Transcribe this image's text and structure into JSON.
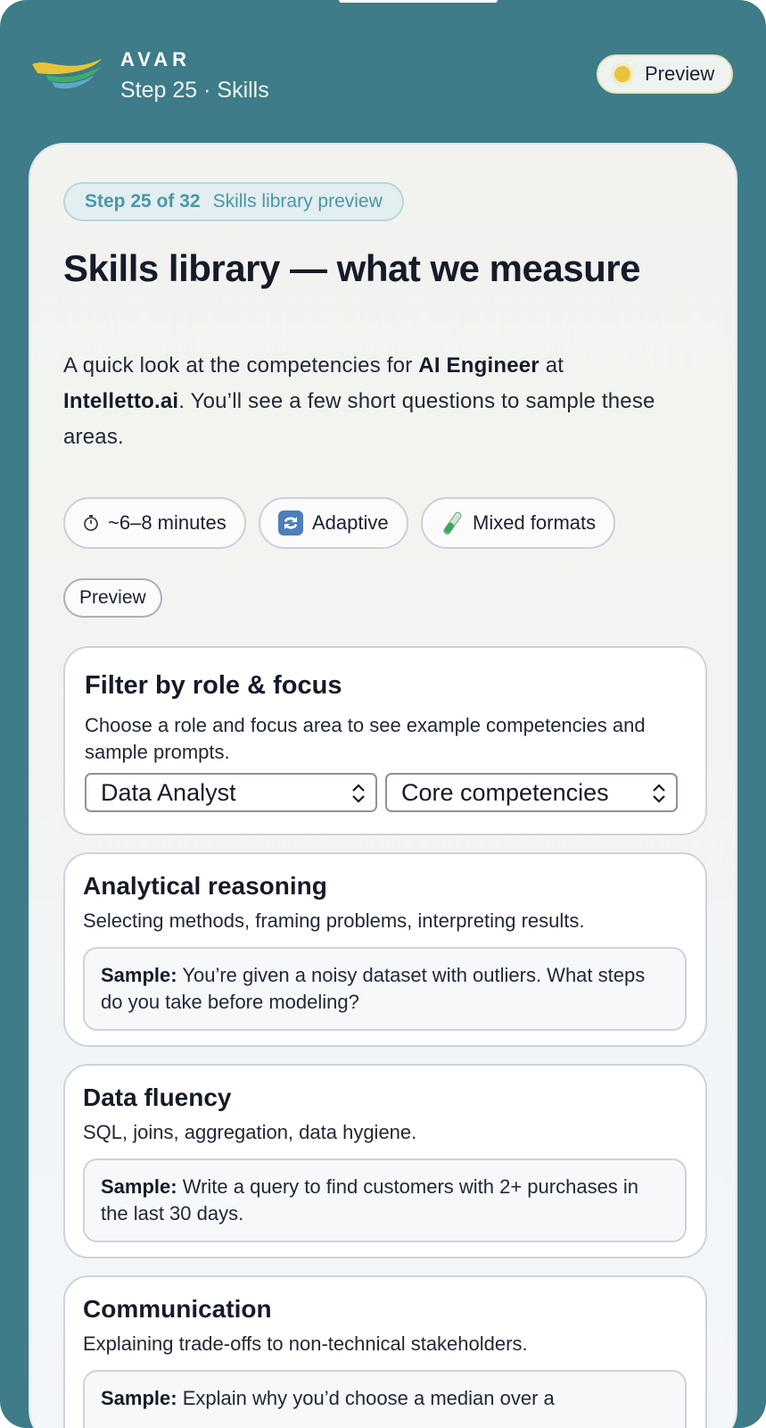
{
  "app": {
    "brand": "AVAR",
    "step_label": "Step 25 · Skills",
    "preview_badge": "Preview"
  },
  "hero": {
    "step_chip": "Step 25 of 32",
    "step_chip_label": "Skills library preview",
    "title": "Skills library — what we measure",
    "intro_prefix": "A quick look at the competencies for ",
    "role": "AI Engineer",
    "intro_mid": " at ",
    "company": "Intelletto.ai",
    "intro_suffix": ". You’ll see a few short questions to sample these areas."
  },
  "tags": [
    {
      "label": "~6–8 minutes",
      "icon": "stopwatch-icon"
    },
    {
      "label": "Adaptive",
      "icon": "repeat-icon"
    },
    {
      "label": "Mixed formats",
      "icon": "test-tube-icon"
    },
    {
      "label": "Preview",
      "icon": ""
    }
  ],
  "filter": {
    "title": "Filter by role & focus",
    "description": "Choose a role and focus area to see example competencies and sample prompts.",
    "role_value": "Data Analyst",
    "focus_value": "Core competencies"
  },
  "skills": [
    {
      "title": "Analytical reasoning",
      "description": "Selecting methods, framing problems, interpreting results.",
      "sample_label": "Sample:",
      "sample_text": "You’re given a noisy dataset with outliers. What steps do you take before modeling?"
    },
    {
      "title": "Data fluency",
      "description": "SQL, joins, aggregation, data hygiene.",
      "sample_label": "Sample:",
      "sample_text": "Write a query to find customers with 2+ purchases in the last 30 days."
    },
    {
      "title": "Communication",
      "description": "Explaining trade-offs to non-technical stakeholders.",
      "sample_label": "Sample:",
      "sample_text": "Explain why you’d choose a median over a"
    }
  ],
  "colors": {
    "frame": "#3d7c88",
    "accent_teal": "#4b97a7",
    "badge_dot": "#e6c53d"
  }
}
